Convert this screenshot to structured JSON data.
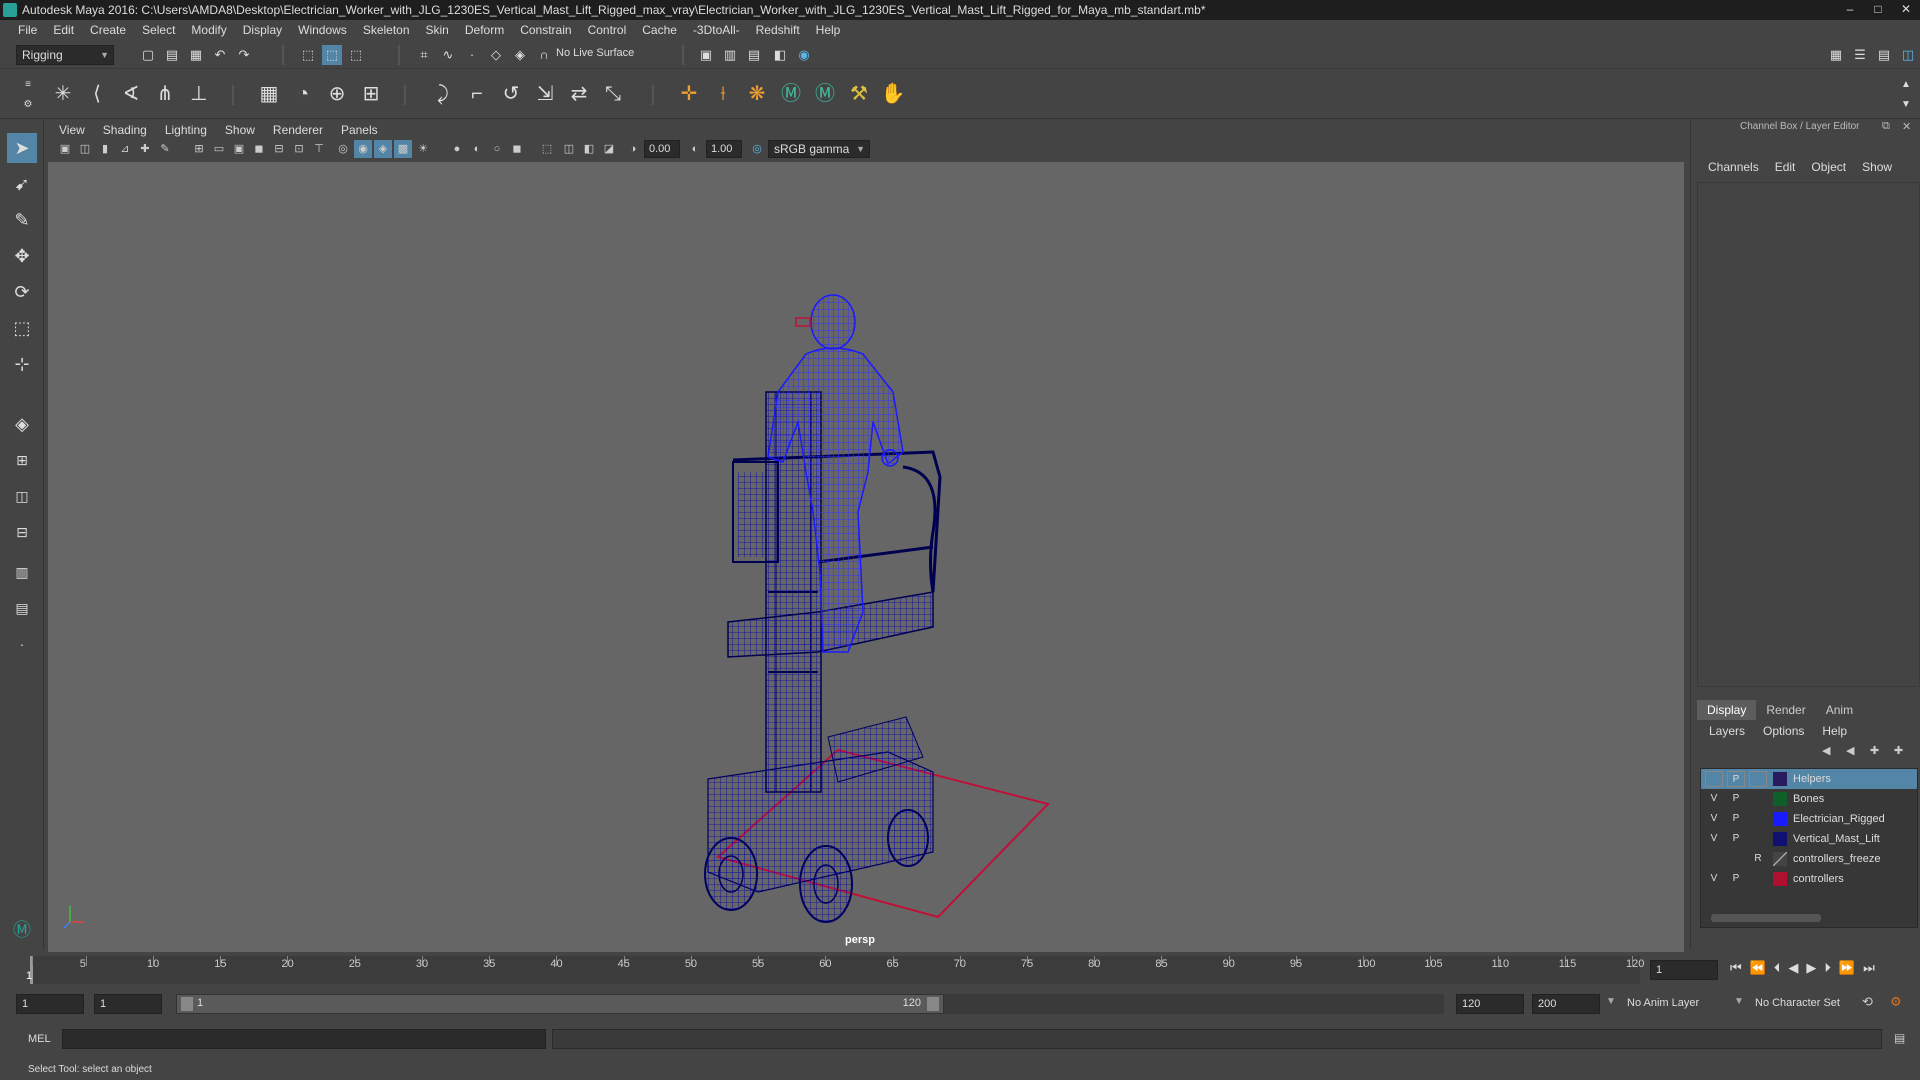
{
  "window": {
    "title": "Autodesk Maya 2016: C:\\Users\\AMDA8\\Desktop\\Electrician_Worker_with_JLG_1230ES_Vertical_Mast_Lift_Rigged_max_vray\\Electrician_Worker_with_JLG_1230ES_Vertical_Mast_Lift_Rigged_for_Maya_mb_standart.mb*",
    "minimize": "–",
    "maximize": "□",
    "close": "✕"
  },
  "menubar": [
    "File",
    "Edit",
    "Create",
    "Select",
    "Modify",
    "Display",
    "Windows",
    "Skeleton",
    "Skin",
    "Deform",
    "Constrain",
    "Control",
    "Cache",
    "-3DtoAll-",
    "Redshift",
    "Help"
  ],
  "status": {
    "mode": "Rigging",
    "live_surface": "No Live Surface"
  },
  "viewport": {
    "menu": [
      "View",
      "Shading",
      "Lighting",
      "Show",
      "Renderer",
      "Panels"
    ],
    "exposure": "0.00",
    "gamma": "1.00",
    "color_space": "sRGB gamma",
    "camera_label": "persp"
  },
  "channel_box": {
    "title": "Channel Box / Layer Editor",
    "menu": [
      "Channels",
      "Edit",
      "Object",
      "Show"
    ]
  },
  "layer_editor": {
    "tabs": [
      "Display",
      "Render",
      "Anim"
    ],
    "active_tab": "Display",
    "menu": [
      "Layers",
      "Options",
      "Help"
    ],
    "layers": [
      {
        "v": "",
        "p": "P",
        "r": "",
        "name": "Helpers",
        "color": "#2a1a5e",
        "selected": true
      },
      {
        "v": "V",
        "p": "P",
        "r": "",
        "name": "Bones",
        "color": "#0f5f2a",
        "selected": false
      },
      {
        "v": "V",
        "p": "P",
        "r": "",
        "name": "Electrician_Rigged",
        "color": "#1a1aff",
        "selected": false
      },
      {
        "v": "V",
        "p": "P",
        "r": "",
        "name": "Vertical_Mast_Lift",
        "color": "#101070",
        "selected": false
      },
      {
        "v": "",
        "p": "",
        "r": "R",
        "name": "controllers_freeze",
        "color": "#555555",
        "selected": false
      },
      {
        "v": "V",
        "p": "P",
        "r": "",
        "name": "controllers",
        "color": "#b01030",
        "selected": false
      }
    ]
  },
  "timeline": {
    "ticks": [
      "1",
      "5",
      "10",
      "15",
      "20",
      "25",
      "30",
      "35",
      "40",
      "45",
      "50",
      "55",
      "60",
      "65",
      "70",
      "75",
      "80",
      "85",
      "90",
      "95",
      "100",
      "105",
      "110",
      "115",
      "120"
    ],
    "current_frame": "1"
  },
  "range": {
    "start": "1",
    "anim_start": "1",
    "slider_start": "1",
    "slider_end": "120",
    "end": "120",
    "anim_end": "200",
    "anim_layer": "No Anim Layer",
    "char_set": "No Character Set"
  },
  "cmd": {
    "label": "MEL"
  },
  "helpline": "Select Tool: select an object"
}
